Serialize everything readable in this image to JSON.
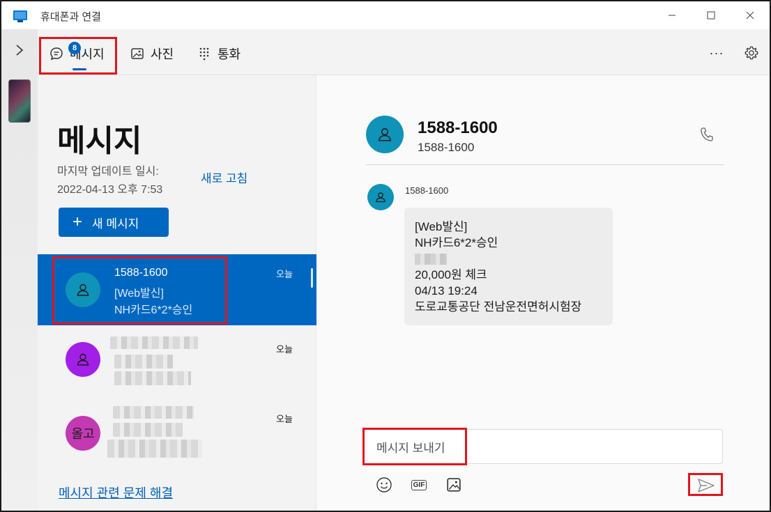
{
  "window": {
    "title": "휴대폰과 연결",
    "minimize_label": "─",
    "maximize_label": "☐",
    "close_label": "✕"
  },
  "nav": {
    "tabs": [
      {
        "label": "메시지",
        "badge": "8",
        "icon": "chat-icon",
        "selected": true
      },
      {
        "label": "사진",
        "icon": "photo-icon"
      },
      {
        "label": "통화",
        "icon": "dialpad-icon"
      }
    ],
    "more_label": "···",
    "settings_icon": "gear-icon"
  },
  "list": {
    "title": "메시지",
    "update_label": "마지막 업데이트 일시:",
    "update_time": "2022-04-13 오후 7:53",
    "refresh_label": "새로 고침",
    "new_message_label": "새 메시지",
    "conversations": [
      {
        "name": "1588-1600",
        "line1": "[Web발신]",
        "line2": "NH카드6*2*승인",
        "time": "오늘",
        "avatar_color": "#0f93b8",
        "selected": true
      },
      {
        "name": "",
        "line1": "",
        "line2": "",
        "time": "오늘",
        "avatar_color": "#a21fe8"
      },
      {
        "name": "",
        "line1": "",
        "line2": "",
        "time": "오늘",
        "avatar_color": "#c239b3",
        "avatar_text": "올고"
      }
    ],
    "troubleshoot_label": "메시지 관련 문제 해결"
  },
  "chat": {
    "contact_name": "1588-1600",
    "contact_number": "1588-1600",
    "message": {
      "sender": "1588-1600",
      "lines": [
        "[Web발신]",
        "NH카드6*2*승인",
        "",
        "20,000원 체크",
        "04/13 19:24",
        "도로교통공단 전남운전면허시험장"
      ]
    },
    "compose_placeholder": "메시지 보내기"
  },
  "colors": {
    "accent": "#0067c0",
    "highlight": "#e4141c"
  }
}
